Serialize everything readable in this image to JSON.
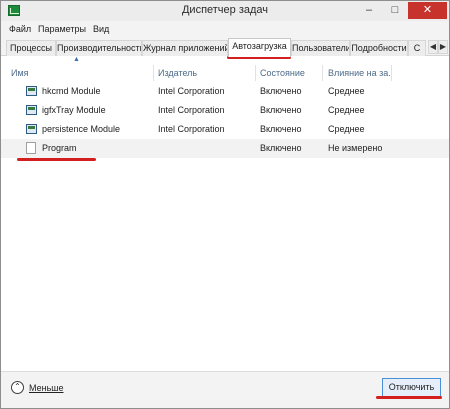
{
  "window": {
    "title": "Диспетчер задач"
  },
  "menu": {
    "items": [
      {
        "label": "Файл"
      },
      {
        "label": "Параметры"
      },
      {
        "label": "Вид"
      }
    ]
  },
  "tabs": [
    {
      "label": "Процессы"
    },
    {
      "label": "Производительность"
    },
    {
      "label": "Журнал приложений"
    },
    {
      "label": "Автозагрузка",
      "active": true
    },
    {
      "label": "Пользователи"
    },
    {
      "label": "Подробности"
    },
    {
      "label": "С"
    }
  ],
  "table": {
    "columns": [
      "Имя",
      "Издатель",
      "Состояние",
      "Влияние на за..."
    ],
    "rows": [
      {
        "name": "hkcmd Module",
        "publisher": "Intel Corporation",
        "status": "Включено",
        "impact": "Среднее",
        "icon": "app-icon"
      },
      {
        "name": "igfxTray Module",
        "publisher": "Intel Corporation",
        "status": "Включено",
        "impact": "Среднее",
        "icon": "app-icon"
      },
      {
        "name": "persistence Module",
        "publisher": "Intel Corporation",
        "status": "Включено",
        "impact": "Среднее",
        "icon": "app-icon"
      },
      {
        "name": "Program",
        "publisher": "",
        "status": "Включено",
        "impact": "Не измерено",
        "icon": "file-icon",
        "selected": true
      }
    ]
  },
  "footer": {
    "less_label": "Меньше",
    "disable_button": "Отключить"
  },
  "colors": {
    "annotation": "#d41f1f",
    "close_button": "#c7332c",
    "accent": "#4a90d9"
  }
}
